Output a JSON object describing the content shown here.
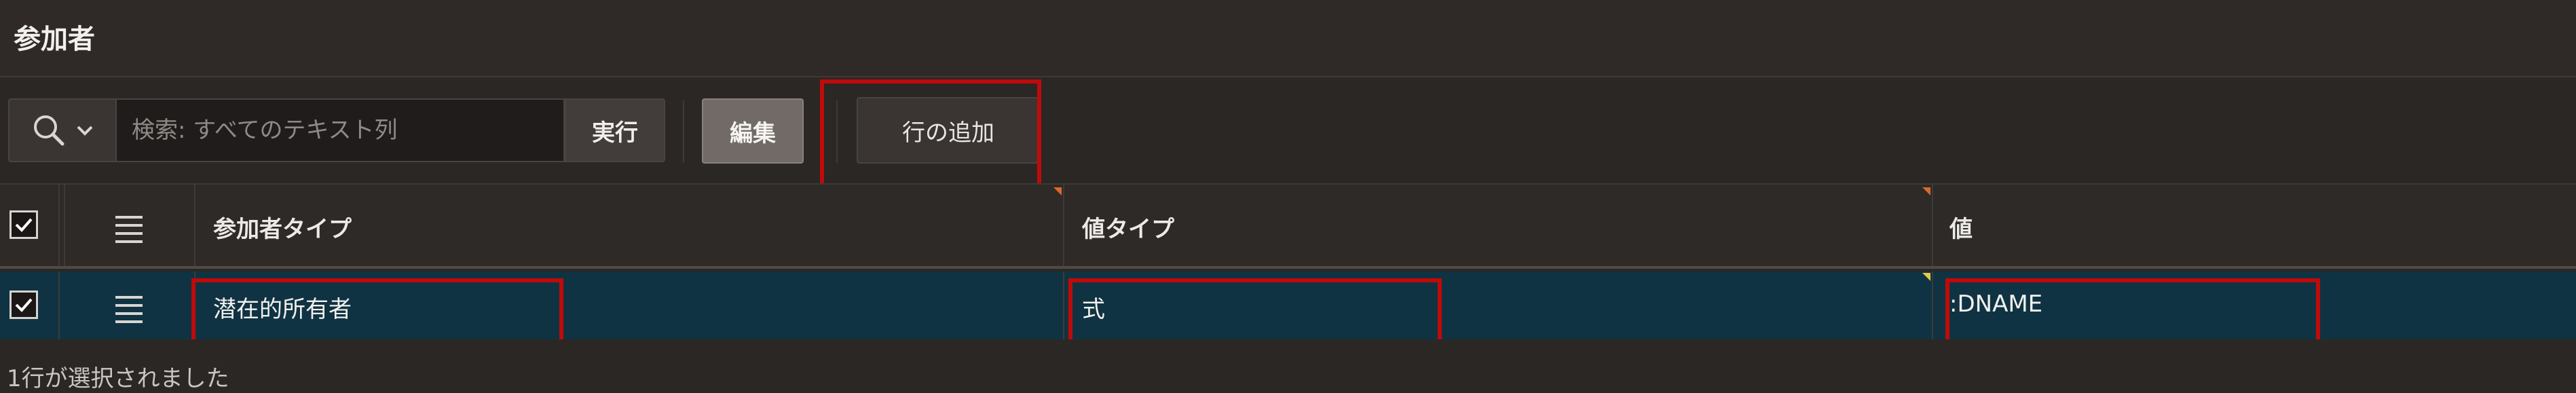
{
  "region": {
    "title": "参加者"
  },
  "toolbar": {
    "search_placeholder": "検索: すべてのテキスト列",
    "go_label": "実行",
    "edit_label": "編集",
    "add_row_label": "行の追加"
  },
  "grid": {
    "columns": [
      "参加者タイプ",
      "値タイプ",
      "値"
    ],
    "rows": [
      {
        "participant_type": "潜在的所有者",
        "value_type": "式",
        "value": ":DNAME"
      }
    ]
  },
  "footer": {
    "status": "1行が選択されました"
  },
  "colors": {
    "highlight": "#c00a0a",
    "selected_row": "#0f3342"
  },
  "icons": [
    "search-icon",
    "chevron-down-icon",
    "checkbox-checked-icon",
    "row-menu-icon"
  ]
}
